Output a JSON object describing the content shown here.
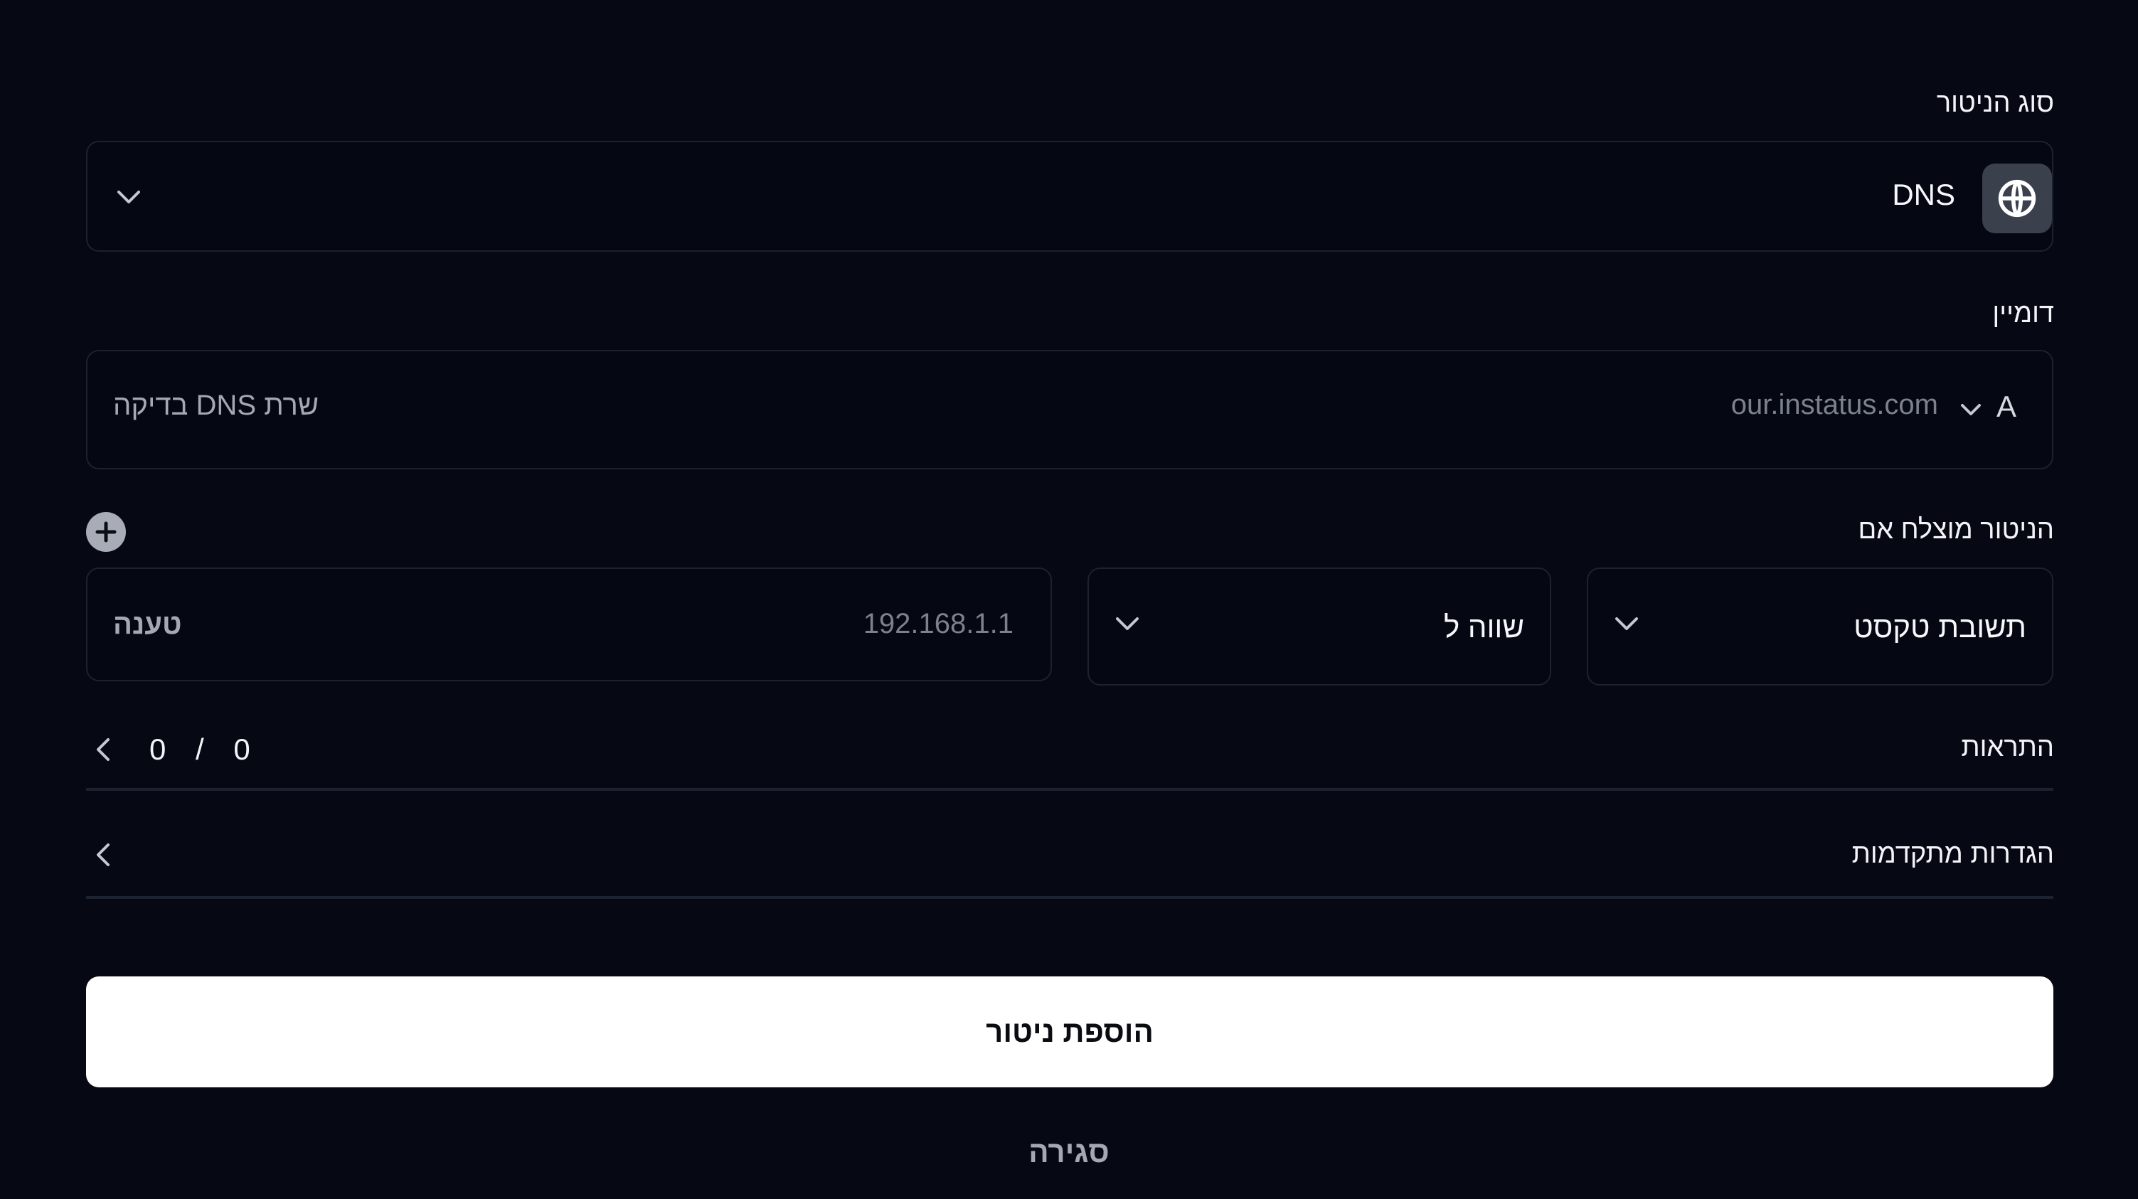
{
  "monitor_type": {
    "label": "סוג הניטור",
    "selected_value": "DNS",
    "icon": "globe-icon"
  },
  "domain": {
    "label": "דומיין",
    "record_type": "A",
    "placeholder": "our.instatus.com",
    "dns_server_hint": "שרת DNS בדיקה"
  },
  "success_condition": {
    "label": "הניטור מוצלח אם",
    "field_value": "תשובת טקסט",
    "operator_value": "שווה ל",
    "value_placeholder": "192.168.1.1",
    "value_hint": "טענה"
  },
  "alerts": {
    "label": "התראות",
    "counter": "0 / 0"
  },
  "advanced": {
    "label": "הגדרות מתקדמות"
  },
  "actions": {
    "submit_label": "הוספת ניטור",
    "close_label": "סגירה"
  },
  "colors": {
    "background": "#060913",
    "border": "#1b2231",
    "primary_button": "#ffffff",
    "icon_badge": "#3a404c"
  }
}
